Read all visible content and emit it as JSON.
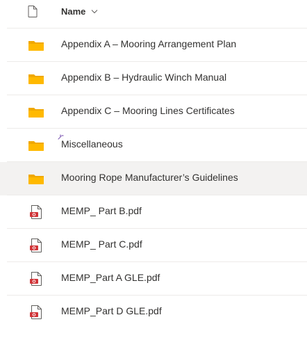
{
  "header": {
    "column_label": "Name",
    "sort_icon": "chevron-down-icon",
    "type_icon": "document-icon"
  },
  "colors": {
    "folder": "#ffb900",
    "folder_tab": "#f0a800",
    "pdf_red": "#d13438",
    "selected_row": "#f3f2f1",
    "new_marker": "#8764b8"
  },
  "items": [
    {
      "name": "Appendix A – Mooring Arrangement Plan",
      "type": "folder",
      "icon": "folder-icon"
    },
    {
      "name": "Appendix B – Hydraulic Winch Manual",
      "type": "folder",
      "icon": "folder-icon"
    },
    {
      "name": "Appendix C – Mooring Lines Certificates",
      "type": "folder",
      "icon": "folder-icon"
    },
    {
      "name": "Miscellaneous",
      "type": "folder",
      "icon": "folder-icon",
      "new_item_marker": true
    },
    {
      "name": "Mooring Rope Manufacturer’s Guidelines",
      "type": "folder",
      "icon": "folder-icon",
      "selected": true
    },
    {
      "name": "MEMP_ Part B.pdf",
      "type": "pdf",
      "icon": "pdf-file-icon"
    },
    {
      "name": "MEMP_ Part C.pdf",
      "type": "pdf",
      "icon": "pdf-file-icon"
    },
    {
      "name": "MEMP_Part A GLE.pdf",
      "type": "pdf",
      "icon": "pdf-file-icon"
    },
    {
      "name": "MEMP_Part D GLE.pdf",
      "type": "pdf",
      "icon": "pdf-file-icon"
    }
  ]
}
